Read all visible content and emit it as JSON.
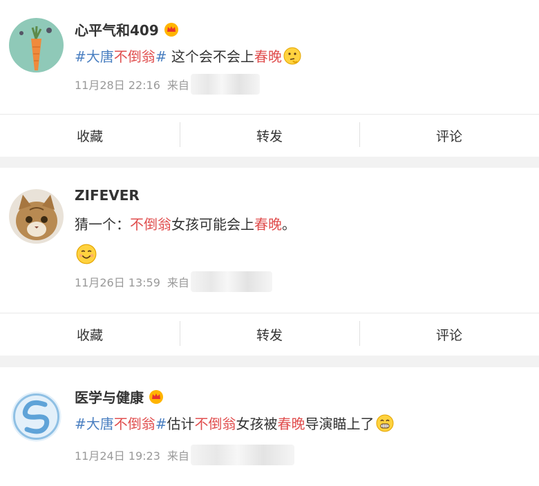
{
  "posts": [
    {
      "username": "心平气和409",
      "text_parts": [
        "#大唐",
        "不倒翁",
        "#",
        " 这个会不会上",
        "春晚"
      ],
      "time": "11月28日 22:16",
      "source_prefix": "来自",
      "avatar": "carrot-avatar",
      "actions": [
        "收藏",
        "转发",
        "评论"
      ]
    },
    {
      "username": "ZIFEVER",
      "text_parts": [
        "猜一个：",
        "不倒翁",
        "女孩可能会上",
        "春晚",
        "。"
      ],
      "time": "11月26日 13:59",
      "source_prefix": "来自",
      "avatar": "cat-avatar",
      "actions": [
        "收藏",
        "转发",
        "评论"
      ]
    },
    {
      "username": "医学与健康",
      "text_parts": [
        "#大唐",
        "不倒翁",
        "#",
        "估计",
        "不倒翁",
        "女孩被",
        "春晚",
        "导演瞄上了"
      ],
      "time": "11月24日 19:23",
      "source_prefix": "来自",
      "avatar": "swirl-logo-avatar"
    }
  ],
  "colors": {
    "topic": "#4a7fc1",
    "highlight": "#e04e4e",
    "meta": "#999999",
    "separator": "#f2f2f2"
  }
}
